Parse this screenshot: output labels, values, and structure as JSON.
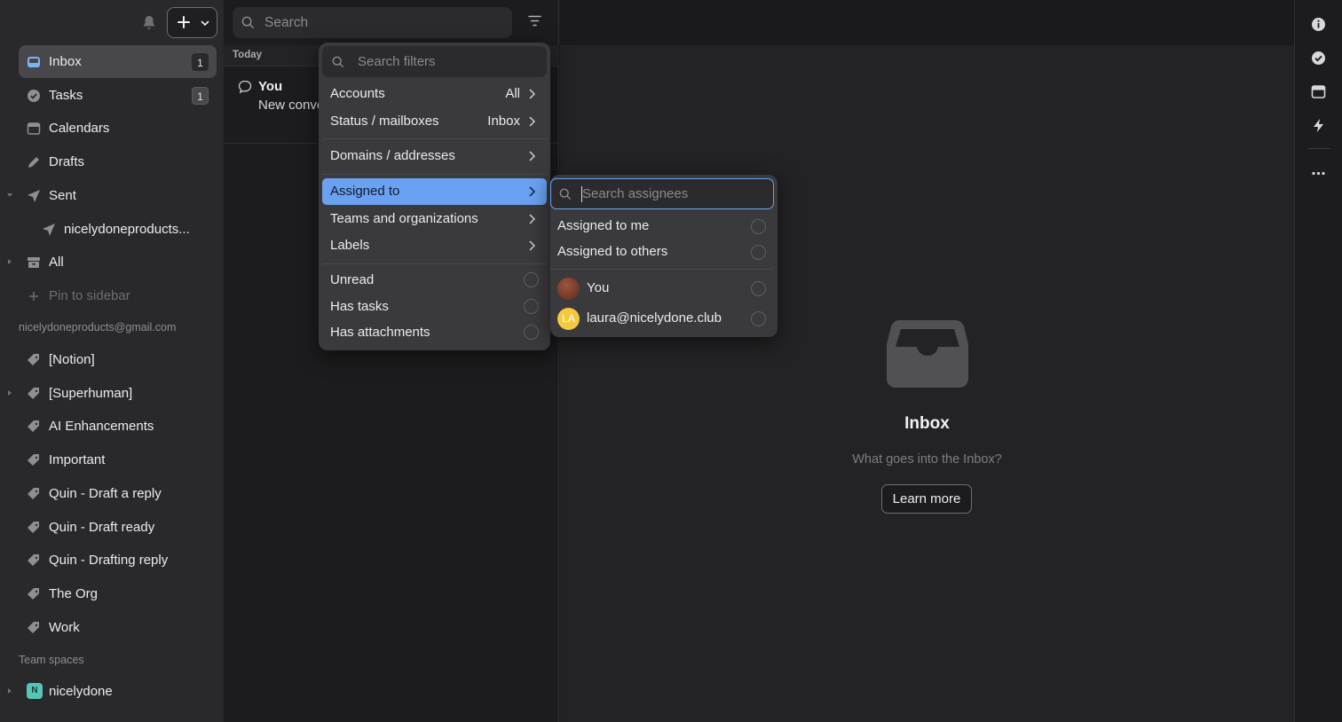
{
  "sidebar": {
    "nav": [
      {
        "label": "Inbox",
        "badge": "1"
      },
      {
        "label": "Tasks",
        "badge": "1"
      },
      {
        "label": "Calendars"
      },
      {
        "label": "Drafts"
      },
      {
        "label": "Sent"
      },
      {
        "label": "nicelydoneproducts..."
      },
      {
        "label": "All"
      },
      {
        "label": "Pin to sidebar"
      }
    ],
    "account_header": "nicelydoneproducts@gmail.com",
    "labels": [
      "[Notion]",
      "[Superhuman]",
      "AI Enhancements",
      "Important",
      "Quin - Draft a reply",
      "Quin - Draft ready",
      "Quin - Drafting reply",
      "The Org",
      "Work"
    ],
    "team_header": "Team spaces",
    "team": {
      "initial": "N",
      "label": "nicelydone"
    }
  },
  "search": {
    "placeholder": "Search"
  },
  "list": {
    "section": "Today",
    "conversation": {
      "from": "You",
      "subject": "New conve"
    }
  },
  "filter_menu": {
    "search_placeholder": "Search filters",
    "items": [
      {
        "label": "Accounts",
        "value": "All"
      },
      {
        "label": "Status / mailboxes",
        "value": "Inbox"
      },
      {
        "label": "Domains / addresses"
      },
      {
        "label": "Assigned to"
      },
      {
        "label": "Teams and organizations"
      },
      {
        "label": "Labels"
      },
      {
        "label": "Unread"
      },
      {
        "label": "Has tasks"
      },
      {
        "label": "Has attachments"
      }
    ]
  },
  "assignee_menu": {
    "search_placeholder": "Search assignees",
    "options": [
      "Assigned to me",
      "Assigned to others"
    ],
    "people": [
      {
        "label": "You"
      },
      {
        "label": "laura@nicelydone.club",
        "initials": "LA"
      }
    ]
  },
  "empty_state": {
    "title": "Inbox",
    "subtitle": "What goes into the Inbox?",
    "button": "Learn more"
  },
  "colors": {
    "selected": "#6aa1f0",
    "accent_avatar": "#f5c842",
    "team_badge": "#55c5b5"
  },
  "icons": [
    "bell-icon",
    "plus-icon",
    "chevron-down-icon",
    "search-icon",
    "filter-icon",
    "info-icon",
    "check-circle-icon",
    "calendar-icon",
    "bolt-icon",
    "more-icon"
  ]
}
